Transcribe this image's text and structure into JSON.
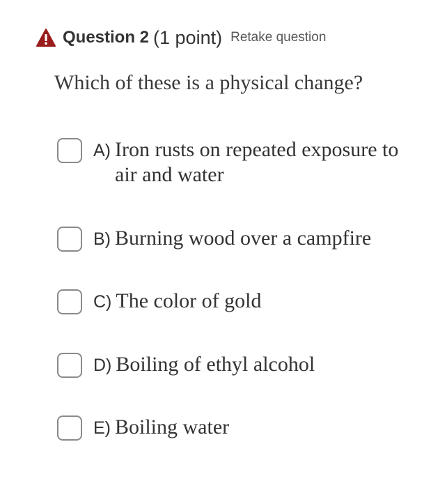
{
  "question": {
    "title": "Question 2",
    "points": "(1 point)",
    "retake_label": "Retake question",
    "prompt": "Which of these is a physical change?"
  },
  "icons": {
    "status": "warning-icon"
  },
  "colors": {
    "warning": "#9b1c1c",
    "checkbox_border": "#8a8a8a",
    "text": "#333333"
  },
  "options": [
    {
      "letter": "A)",
      "text": "Iron rusts on repeated exposure to air and water"
    },
    {
      "letter": "B)",
      "text": "Burning wood over a campfire"
    },
    {
      "letter": "C)",
      "text": "The color of gold"
    },
    {
      "letter": "D)",
      "text": "Boiling of ethyl alcohol"
    },
    {
      "letter": "E)",
      "text": "Boiling water"
    }
  ]
}
